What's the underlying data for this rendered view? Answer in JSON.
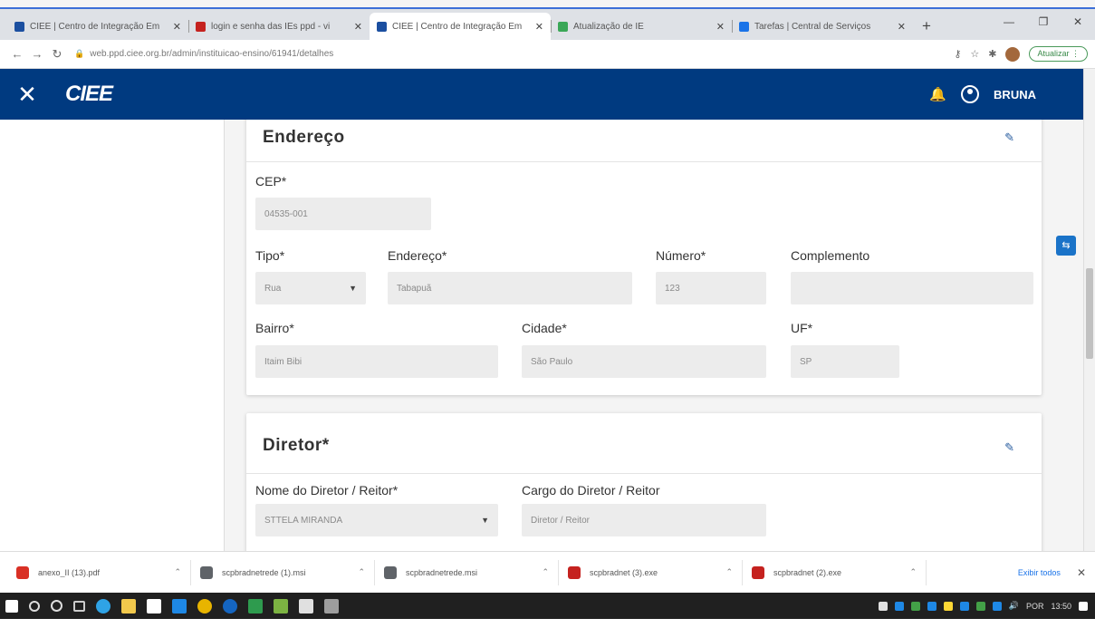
{
  "browser": {
    "tabs": [
      {
        "title": "CIEE | Centro de Integração Em",
        "color": "#1b4fa0",
        "active": false
      },
      {
        "title": "login e senha das IEs ppd - vi",
        "color": "#c5221f",
        "active": false
      },
      {
        "title": "CIEE | Centro de Integração Em",
        "color": "#1b4fa0",
        "active": true
      },
      {
        "title": "Atualização de IE",
        "color": "#3aa757",
        "active": false
      },
      {
        "title": "Tarefas | Central de Serviços",
        "color": "#1a73e8",
        "active": false
      }
    ],
    "url": "web.ppd.ciee.org.br/admin/instituicao-ensino/61941/detalhes",
    "update_label": "Atualizar"
  },
  "app": {
    "logo_text": "CIEE",
    "username": "BRUNA",
    "brand_color": "#003a80"
  },
  "endereco": {
    "title": "Endereço",
    "cep_label": "CEP*",
    "cep_value": "04535-001",
    "tipo_label": "Tipo*",
    "tipo_value": "Rua",
    "endereco_label": "Endereço*",
    "endereco_value": "Tabapuã",
    "numero_label": "Número*",
    "numero_value": "123",
    "complemento_label": "Complemento",
    "complemento_value": "",
    "bairro_label": "Bairro*",
    "bairro_value": "Itaim Bibi",
    "cidade_label": "Cidade*",
    "cidade_value": "São Paulo",
    "uf_label": "UF*",
    "uf_value": "SP"
  },
  "diretor": {
    "title": "Diretor*",
    "nome_label": "Nome do Diretor / Reitor*",
    "nome_value": "STTELA MIRANDA",
    "cargo_label": "Cargo do Diretor / Reitor",
    "cargo_value": "Diretor / Reitor"
  },
  "downloads": {
    "items": [
      {
        "name": "anexo_II (13).pdf",
        "color": "#d93025"
      },
      {
        "name": "scpbradnetrede (1).msi",
        "color": "#5f6368"
      },
      {
        "name": "scpbradnetrede.msi",
        "color": "#5f6368"
      },
      {
        "name": "scpbradnet (3).exe",
        "color": "#c5221f"
      },
      {
        "name": "scpbradnet (2).exe",
        "color": "#c5221f"
      }
    ],
    "show_all": "Exibir todos"
  },
  "taskbar": {
    "lang": "POR",
    "time": "13:50"
  }
}
